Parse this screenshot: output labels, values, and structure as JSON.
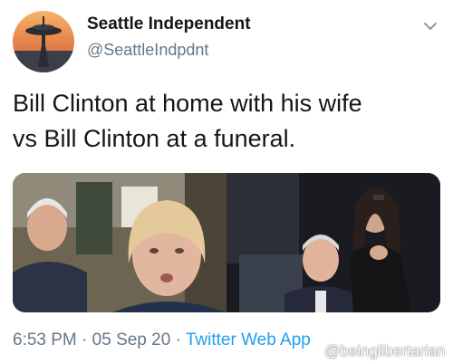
{
  "tweet": {
    "author_name": "Seattle Independent",
    "author_handle": "@SeattleIndpdnt",
    "text_line1": "Bill Clinton at home with his wife",
    "text_line2": "vs Bill Clinton at a funeral.",
    "time": "6:53 PM",
    "separator": "·",
    "date": "05 Sep 20",
    "source": "Twitter Web App",
    "media_panels": 2
  },
  "watermark": "@beinglibertarian",
  "icons": {
    "avatar": "space-needle-sunset-avatar",
    "menu": "chevron-down-icon"
  },
  "colors": {
    "text": "#14171a",
    "secondary": "#657786",
    "link": "#1da1f2",
    "background": "#ffffff"
  }
}
